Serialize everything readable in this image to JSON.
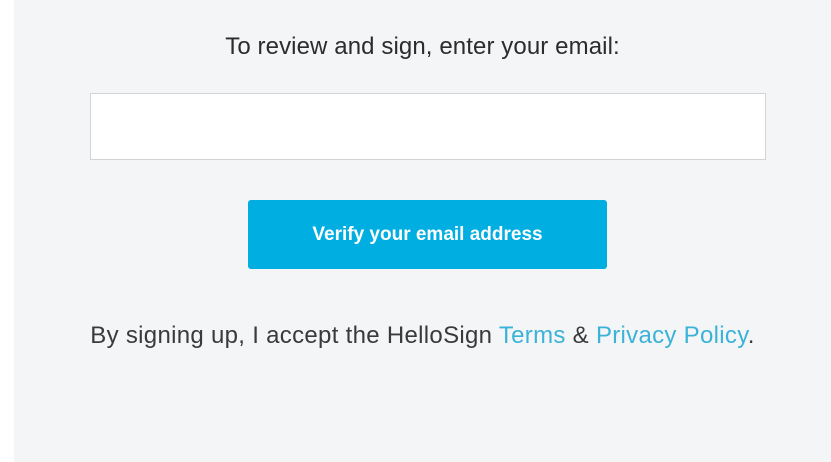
{
  "form": {
    "prompt": "To review and sign, enter your email:",
    "email_value": "",
    "email_placeholder": "",
    "verify_label": "Verify your email address"
  },
  "legal": {
    "prefix": "By signing up, I accept the HelloSign ",
    "terms_label": "Terms",
    "amp": " & ",
    "privacy_label": "Privacy Policy",
    "suffix": "."
  },
  "colors": {
    "accent": "#00aee2",
    "link": "#3bb3d8",
    "background": "#f4f5f7"
  }
}
